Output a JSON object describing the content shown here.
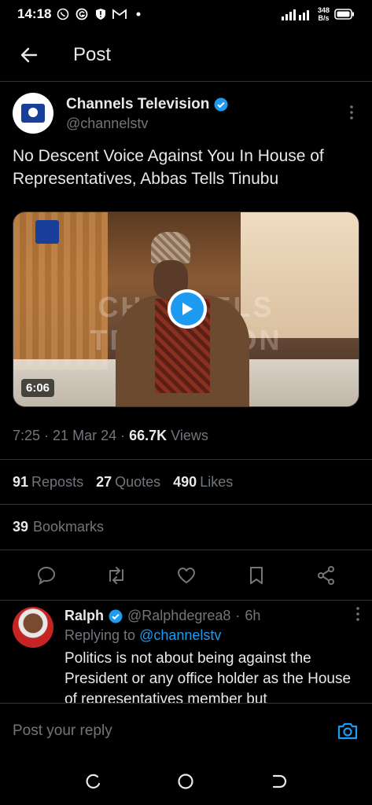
{
  "status": {
    "time": "14:18",
    "net_speed": "348",
    "net_unit": "B/s"
  },
  "header": {
    "title": "Post"
  },
  "tweet": {
    "display_name": "Channels Television",
    "handle": "@channelstv",
    "text": "No Descent Voice Against You In House of Representatives, Abbas Tells Tinubu",
    "media": {
      "watermark": "CHANNELS TELEVISION",
      "duration": "6:06"
    },
    "time": "7:25",
    "date": "21 Mar 24",
    "views_count": "66.7K",
    "views_label": "Views",
    "reposts_count": "91",
    "reposts_label": "Reposts",
    "quotes_count": "27",
    "quotes_label": "Quotes",
    "likes_count": "490",
    "likes_label": "Likes",
    "bookmarks_count": "39",
    "bookmarks_label": "Bookmarks"
  },
  "reply": {
    "display_name": "Ralph",
    "handle": "@Ralphdegrea8",
    "age": "6h",
    "replying_prefix": "Replying to",
    "replying_to": "@channelstv",
    "text": "Politics is not about being against the President or any office holder as the House of representatives member but"
  },
  "compose": {
    "placeholder": "Post your reply"
  },
  "colors": {
    "accent": "#1d9bf0",
    "bg": "#000000",
    "muted": "#71767b",
    "divider": "#2f3336"
  }
}
